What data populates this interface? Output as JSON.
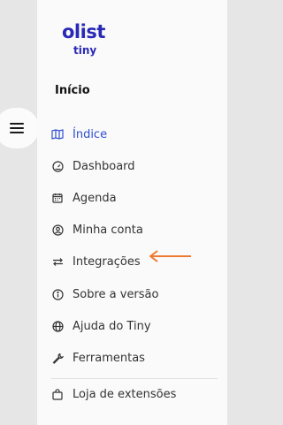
{
  "logo": {
    "brand": "olist",
    "product": "tiny"
  },
  "section_title": "Início",
  "nav": {
    "items": [
      {
        "label": "Índice",
        "icon": "map-icon",
        "active": true
      },
      {
        "label": "Dashboard",
        "icon": "gauge-icon"
      },
      {
        "label": "Agenda",
        "icon": "calendar-icon"
      },
      {
        "label": "Minha conta",
        "icon": "user-icon"
      },
      {
        "label": "Integrações",
        "icon": "arrows-exchange-icon"
      },
      {
        "label": "Sobre a versão",
        "icon": "info-icon"
      },
      {
        "label": "Ajuda do Tiny",
        "icon": "globe-icon"
      },
      {
        "label": "Ferramentas",
        "icon": "wrench-icon"
      },
      {
        "label": "Loja de extensões",
        "icon": "shopping-bag-icon"
      }
    ]
  },
  "colors": {
    "accent": "#2d4fd1",
    "brand": "#2929b8",
    "annotation_arrow": "#ee7a32"
  }
}
